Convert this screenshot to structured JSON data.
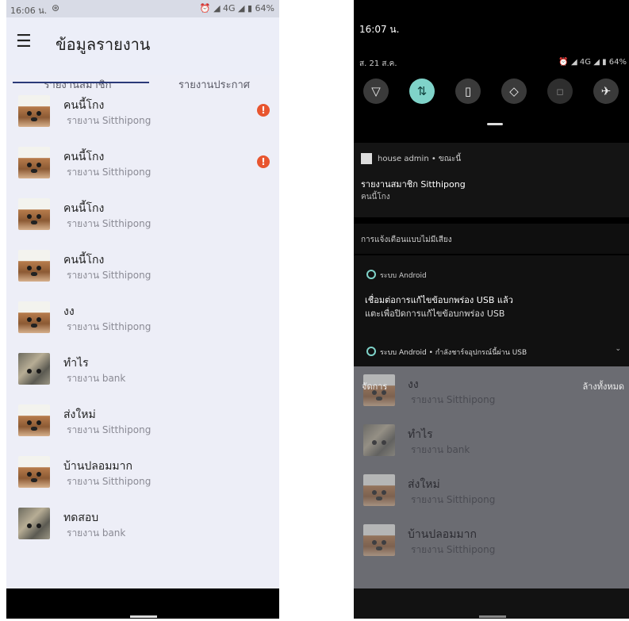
{
  "left": {
    "status": {
      "time": "16:06 น.",
      "icons": "⏰ ◢ 4G ◢ ▮ 64%",
      "alarm": "⊛"
    },
    "app_title": "ข้อมูลรายงาน",
    "tabs": [
      "รายงานสมาชิก",
      "รายงานประกาศ"
    ],
    "items": [
      {
        "title": "คนนี้โกง",
        "subtitle": "รายงาน Sitthipong",
        "avatar": "dog",
        "alert": "!"
      },
      {
        "title": "คนนี้โกง",
        "subtitle": "รายงาน Sitthipong",
        "avatar": "dog",
        "alert": "!"
      },
      {
        "title": "คนนี้โกง",
        "subtitle": "รายงาน Sitthipong",
        "avatar": "dog"
      },
      {
        "title": "คนนี้โกง",
        "subtitle": "รายงาน Sitthipong",
        "avatar": "dog"
      },
      {
        "title": "งง",
        "subtitle": "รายงาน Sitthipong",
        "avatar": "dog"
      },
      {
        "title": "ทำไร",
        "subtitle": "รายงาน bank",
        "avatar": "cat"
      },
      {
        "title": "ส่งใหม่",
        "subtitle": "รายงาน Sitthipong",
        "avatar": "dog"
      },
      {
        "title": "บ้านปลอมมาก",
        "subtitle": "รายงาน Sitthipong",
        "avatar": "dog"
      },
      {
        "title": "ทดสอบ",
        "subtitle": "รายงาน bank",
        "avatar": "cat"
      }
    ]
  },
  "right": {
    "time": "16:07 น.",
    "date": "ส. 21 ส.ค.",
    "status_icons": "⏰ ◢ 4G ◢ ▮ 64%",
    "quick_settings": [
      "wifi-icon",
      "data-icon",
      "flashlight-icon",
      "rotate-icon",
      "battery-saver-icon",
      "airplane-icon"
    ],
    "notification1": {
      "meta": "house admin • ขณะนี้",
      "title": "รายงานสมาชิก Sitthipong",
      "text": "คนนี้โกง"
    },
    "silent_header": "การแจ้งเตือนแบบไม่มีเสียง",
    "system1": {
      "meta": "ระบบ Android",
      "line1": "เชื่อมต่อการแก้ไขข้อบกพร่อง USB แล้ว",
      "line2": "แตะเพื่อปิดการแก้ไขข้อบกพร่อง USB"
    },
    "system2": {
      "meta": "ระบบ Android • กำลังชาร์จอุปกรณ์นี้ผ่าน USB"
    },
    "manage": "จัดการ",
    "clear_all": "ล้างทั้งหมด",
    "items": [
      {
        "title": "งง",
        "subtitle": "รายงาน Sitthipong",
        "avatar": "dog"
      },
      {
        "title": "ทำไร",
        "subtitle": "รายงาน bank",
        "avatar": "cat"
      },
      {
        "title": "ส่งใหม่",
        "subtitle": "รายงาน Sitthipong",
        "avatar": "dog"
      },
      {
        "title": "บ้านปลอมมาก",
        "subtitle": "รายงาน Sitthipong",
        "avatar": "dog"
      }
    ]
  }
}
